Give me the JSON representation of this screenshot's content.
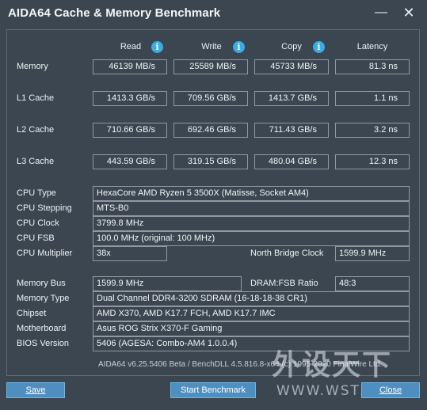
{
  "window": {
    "title": "AIDA64 Cache & Memory Benchmark",
    "minimize_glyph": "—",
    "close_glyph": "✕"
  },
  "columns": {
    "read": "Read",
    "write": "Write",
    "copy": "Copy",
    "latency": "Latency",
    "info_glyph": "i"
  },
  "rows": {
    "memory": {
      "label": "Memory",
      "read": "46139 MB/s",
      "write": "25589 MB/s",
      "copy": "45733 MB/s",
      "latency": "81.3 ns"
    },
    "l1": {
      "label": "L1 Cache",
      "read": "1413.3 GB/s",
      "write": "709.56 GB/s",
      "copy": "1413.7 GB/s",
      "latency": "1.1 ns"
    },
    "l2": {
      "label": "L2 Cache",
      "read": "710.66 GB/s",
      "write": "692.46 GB/s",
      "copy": "711.43 GB/s",
      "latency": "3.2 ns"
    },
    "l3": {
      "label": "L3 Cache",
      "read": "443.59 GB/s",
      "write": "319.15 GB/s",
      "copy": "480.04 GB/s",
      "latency": "12.3 ns"
    }
  },
  "cpu": {
    "type_label": "CPU Type",
    "type_value": "HexaCore AMD Ryzen 5 3500X  (Matisse, Socket AM4)",
    "stepping_label": "CPU Stepping",
    "stepping_value": "MTS-B0",
    "clock_label": "CPU Clock",
    "clock_value": "3799.8 MHz",
    "fsb_label": "CPU FSB",
    "fsb_value": "100.0 MHz  (original: 100 MHz)",
    "multiplier_label": "CPU Multiplier",
    "multiplier_value": "38x",
    "nb_clock_label": "North Bridge Clock",
    "nb_clock_value": "1599.9 MHz"
  },
  "memory_info": {
    "bus_label": "Memory Bus",
    "bus_value": "1599.9 MHz",
    "ratio_label": "DRAM:FSB Ratio",
    "ratio_value": "48:3",
    "type_label": "Memory Type",
    "type_value": "Dual Channel DDR4-3200 SDRAM  (16-18-18-38 CR1)",
    "chipset_label": "Chipset",
    "chipset_value": "AMD X370, AMD K17.7 FCH, AMD K17.7 IMC",
    "motherboard_label": "Motherboard",
    "motherboard_value": "Asus ROG Strix X370-F Gaming",
    "bios_label": "BIOS Version",
    "bios_value": "5406  (AGESA: Combo-AM4 1.0.0.4)"
  },
  "footer": {
    "version_text": "AIDA64 v6.25.5406 Beta / BenchDLL 4.5.816.8-x64  (c) 1995-2020 FinalWire Ltd."
  },
  "buttons": {
    "save": "Save",
    "start": "Start Benchmark",
    "close": "Close"
  },
  "watermark": {
    "cn": "外设天下",
    "url": "WWW.WSTX.COM"
  }
}
